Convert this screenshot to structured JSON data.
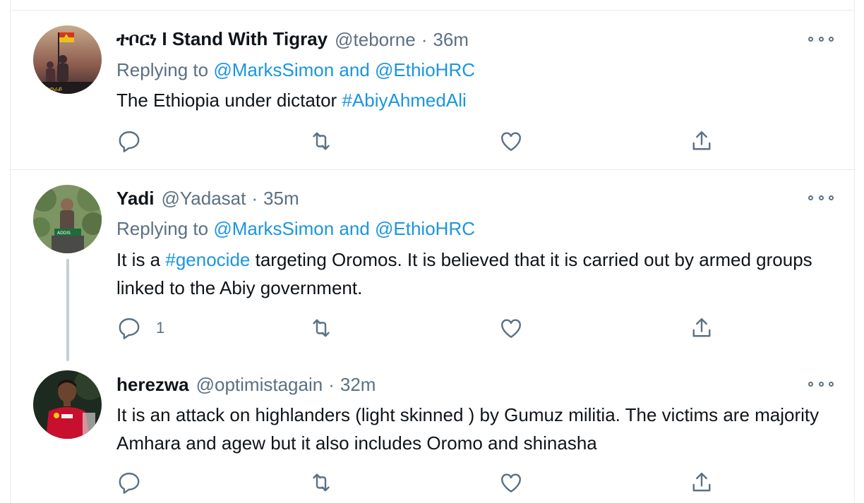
{
  "tweets": [
    {
      "name": "ተቦርነ I Stand With Tigray",
      "handle": "@teborne",
      "sep": "·",
      "time": "36m",
      "replying_label": "Replying to",
      "replying_to": "@MarksSimon and @EthioHRC",
      "text_before": "The Ethiopia under dictator",
      "hashtag": "#AbiyAhmedAli",
      "text_after": "",
      "reply_count": ""
    },
    {
      "name": "Yadi",
      "handle": "@Yadasat",
      "sep": "·",
      "time": "35m",
      "replying_label": "Replying to",
      "replying_to": "@MarksSimon and @EthioHRC",
      "text_before": "It is a",
      "hashtag": "#genocide",
      "text_after": "targeting Oromos. It is believed that it is carried out by armed groups linked to the Abiy government.",
      "reply_count": "1"
    },
    {
      "name": "herezwa",
      "handle": "@optimistagain",
      "sep": "·",
      "time": "32m",
      "text": "It is an attack on highlanders (light skinned ) by Gumuz militia. The victims are majority Amhara and agew but it also includes Oromo and shinasha",
      "reply_count": ""
    }
  ],
  "icons": {
    "reply": "reply-icon",
    "retweet": "retweet-icon",
    "like": "heart-icon",
    "share": "share-icon",
    "more": "more-icon"
  },
  "colors": {
    "link": "#1b95e0",
    "secondary_text": "#5b7083",
    "primary_text": "#0f1419",
    "divider": "#e6ecf0",
    "thread_line": "#c4cfd6"
  }
}
